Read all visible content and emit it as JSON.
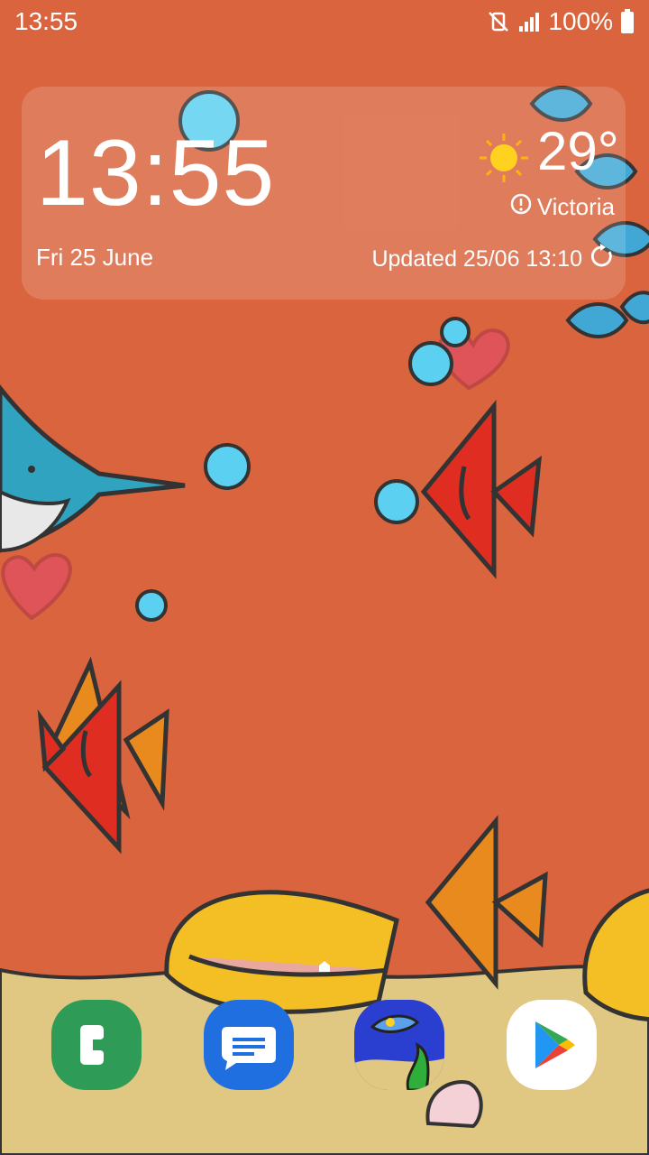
{
  "status_bar": {
    "time": "13:55",
    "battery_text": "100%",
    "icons": [
      "mute-vibrate-icon",
      "signal-icon",
      "battery-icon"
    ]
  },
  "weather_widget": {
    "time": "13:55",
    "date": "Fri 25 June",
    "temperature": "29°",
    "location": "Victoria",
    "updated": "Updated 25/06 13:10",
    "weather_icon": "sun-icon",
    "alert_icon": "alert-icon",
    "refresh_icon": "refresh-icon"
  },
  "dock": {
    "apps": [
      {
        "name": "Phone",
        "icon": "phone-icon",
        "color": "#2e9b57"
      },
      {
        "name": "Messages",
        "icon": "messages-icon",
        "color": "#1f6fe0"
      },
      {
        "name": "Aquarium",
        "icon": "aquarium-app-icon",
        "color": "#2a3fcf"
      },
      {
        "name": "Play Store",
        "icon": "play-store-icon",
        "color": "#ffffff"
      }
    ]
  },
  "colors": {
    "background": "#d9643d",
    "sand": "#e0c782",
    "fish_red": "#e02d22",
    "fish_orange": "#e98a1e",
    "fish_blue": "#41a8d6"
  }
}
